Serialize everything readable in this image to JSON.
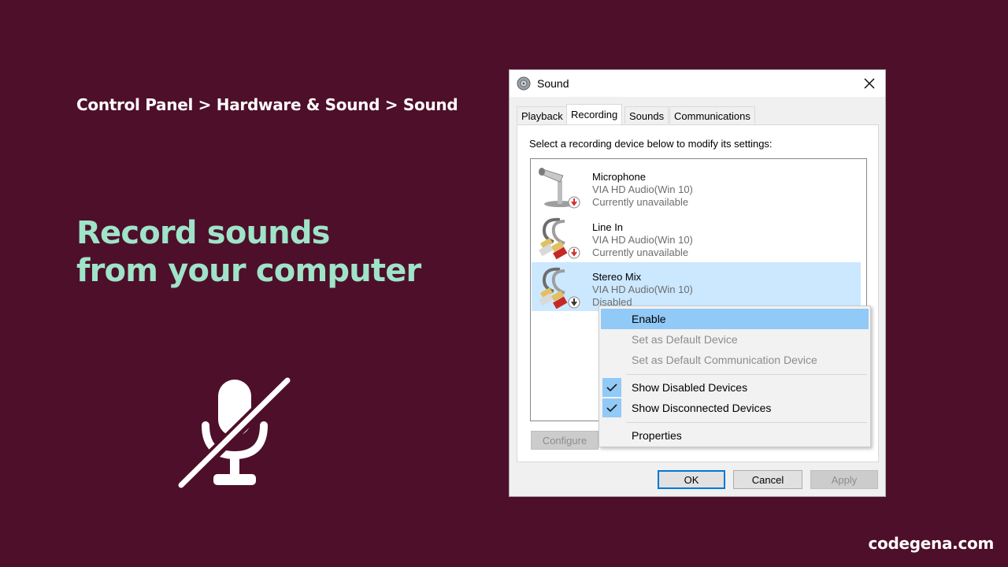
{
  "breadcrumb": "Control Panel > Hardware & Sound > Sound",
  "headline": {
    "line1": "Record sounds",
    "line2": "from your computer"
  },
  "watermark": "codegena.com",
  "icons": {
    "mute": "microphone-muted-icon",
    "title": "speaker-icon",
    "close": "close-icon",
    "check": "checkmark-icon"
  },
  "colors": {
    "background": "#4e0f2a",
    "headline": "#9fe3c9",
    "selection": "#cce8ff",
    "menu_highlight": "#91c9f7"
  },
  "dialog": {
    "title": "Sound",
    "tabs": [
      {
        "label": "Playback",
        "active": false
      },
      {
        "label": "Recording",
        "active": true
      },
      {
        "label": "Sounds",
        "active": false
      },
      {
        "label": "Communications",
        "active": false
      }
    ],
    "instruction": "Select a recording device below to modify its settings:",
    "devices": [
      {
        "name": "Microphone",
        "driver": "VIA HD Audio(Win 10)",
        "status": "Currently unavailable",
        "icon": "microphone-device-icon"
      },
      {
        "name": "Line In",
        "driver": "VIA HD Audio(Win 10)",
        "status": "Currently unavailable",
        "icon": "rca-cable-icon"
      },
      {
        "name": "Stereo Mix",
        "driver": "VIA HD Audio(Win 10)",
        "status": "Disabled",
        "icon": "rca-cable-icon"
      }
    ],
    "configure_label": "Configure",
    "ok_label": "OK",
    "cancel_label": "Cancel",
    "apply_label": "Apply"
  },
  "context_menu": {
    "enable": "Enable",
    "set_default": "Set as Default Device",
    "set_default_comm": "Set as Default Communication Device",
    "show_disabled": "Show Disabled Devices",
    "show_disconnected": "Show Disconnected Devices",
    "properties": "Properties"
  }
}
